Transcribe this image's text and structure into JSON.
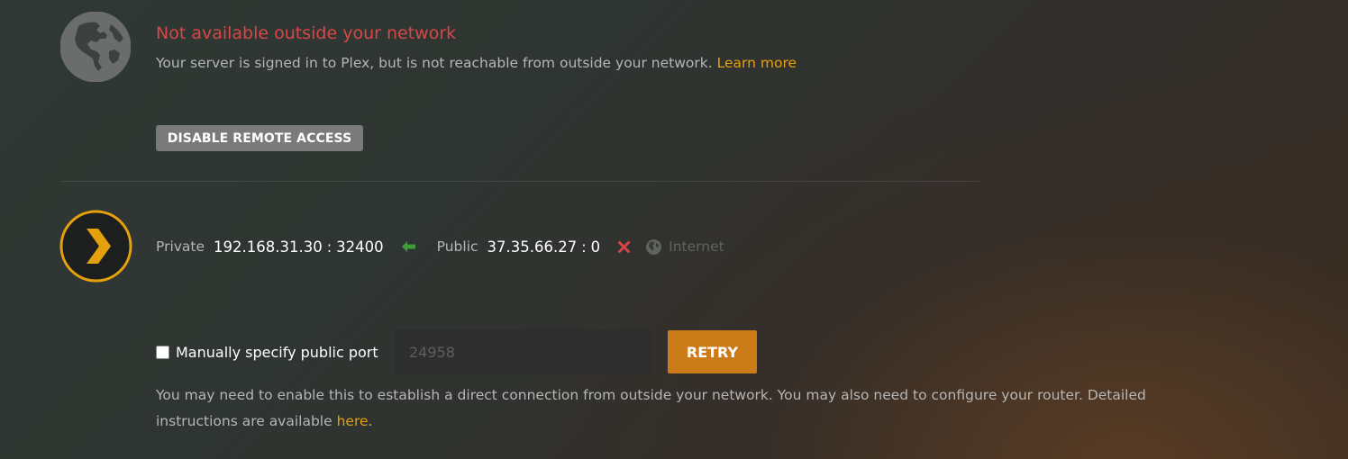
{
  "remote_access": {
    "status_title": "Not available outside your network",
    "status_description": "Your server is signed in to Plex, but is not reachable from outside your network.",
    "learn_more_label": "Learn more",
    "disable_button_label": "DISABLE REMOTE ACCESS"
  },
  "connection": {
    "private_label": "Private",
    "private_ip": "192.168.31.30",
    "private_port": "32400",
    "separator": ":",
    "public_label": "Public",
    "public_ip": "37.35.66.27",
    "public_port": "0",
    "internet_label": "Internet"
  },
  "manual_port": {
    "checkbox_label": "Manually specify public port",
    "checked": false,
    "input_placeholder": "24958",
    "input_value": "",
    "retry_label": "RETRY"
  },
  "help": {
    "text": "You may need to enable this to establish a direct connection from outside your network. You may also need to configure your router. Detailed instructions are available",
    "link_label": "here",
    "end": "."
  },
  "colors": {
    "error": "#d84747",
    "accent": "#e5a00d",
    "retry_button": "#cc7b19",
    "success_arrow": "#3f9a3a",
    "fail_x": "#d64545"
  },
  "icons": {
    "status": "globe-icon",
    "server": "plex-logo",
    "link_ok": "arrow-left-icon",
    "link_fail": "close-icon",
    "internet": "globe-small-icon"
  }
}
